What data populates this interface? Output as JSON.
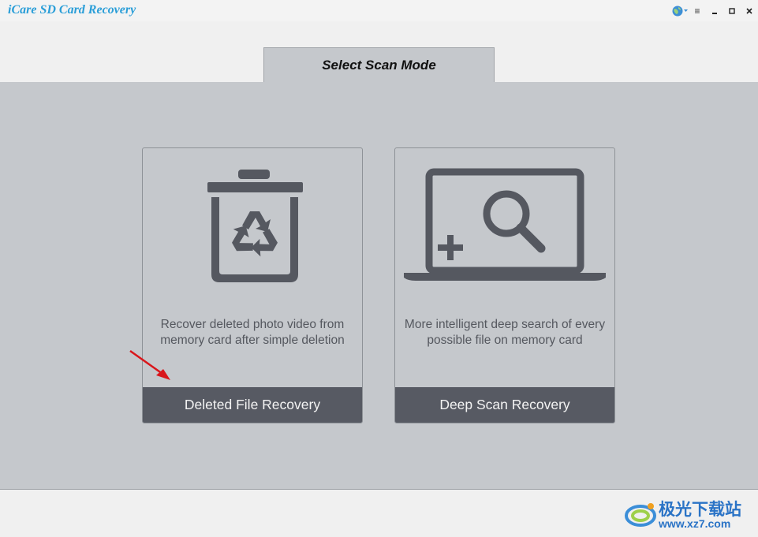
{
  "app": {
    "title": "iCare SD Card Recovery"
  },
  "window_controls": {
    "language_icon": "globe-icon",
    "menu_glyph": "≡",
    "minimize_glyph": "▁",
    "maximize_glyph": "□",
    "close_glyph": "✕"
  },
  "tab": {
    "label": "Select Scan Mode"
  },
  "cards": [
    {
      "icon": "recycle-bin-icon",
      "description": "Recover deleted photo video from memory card after simple deletion",
      "button_label": "Deleted File Recovery"
    },
    {
      "icon": "laptop-search-icon",
      "description": "More intelligent deep search of every possible file on memory card",
      "button_label": "Deep Scan Recovery"
    }
  ],
  "watermark": {
    "line1": "极光下载站",
    "line2": "www.xz7.com"
  },
  "colors": {
    "title_blue": "#2a9ed8",
    "panel_bg": "#c5c8cc",
    "button_bg": "#575a63",
    "icon_gray": "#555860",
    "arrow_red": "#d9161b"
  }
}
